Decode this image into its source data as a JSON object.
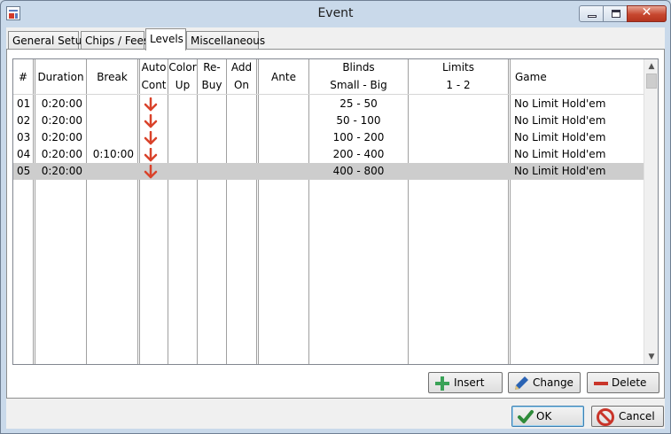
{
  "window": {
    "title": "Event"
  },
  "tabs": [
    {
      "label": "General Setup",
      "active": false
    },
    {
      "label": "Chips / Fees",
      "active": false
    },
    {
      "label": "Levels",
      "active": true
    },
    {
      "label": "Miscellaneous",
      "active": false
    }
  ],
  "columns": {
    "num": "#",
    "duration": "Duration",
    "break": "Break",
    "auto_1": "Auto",
    "auto_2": "Cont",
    "color_1": "Color",
    "color_2": "Up",
    "rebuy_1": "Re-",
    "rebuy_2": "Buy",
    "addon_1": "Add",
    "addon_2": "On",
    "ante": "Ante",
    "blinds_1": "Blinds",
    "blinds_2": "Small - Big",
    "limits_1": "Limits",
    "limits_2": "1 - 2",
    "game": "Game"
  },
  "levels": [
    {
      "num": "01",
      "duration": "0:20:00",
      "break": "",
      "blinds": "25 - 50",
      "game": "No Limit Hold'em",
      "auto_continue": true
    },
    {
      "num": "02",
      "duration": "0:20:00",
      "break": "",
      "blinds": "50 - 100",
      "game": "No Limit Hold'em",
      "auto_continue": true
    },
    {
      "num": "03",
      "duration": "0:20:00",
      "break": "",
      "blinds": "100 - 200",
      "game": "No Limit Hold'em",
      "auto_continue": true
    },
    {
      "num": "04",
      "duration": "0:20:00",
      "break": "0:10:00",
      "blinds": "200 - 400",
      "game": "No Limit Hold'em",
      "auto_continue": true
    },
    {
      "num": "05",
      "duration": "0:20:00",
      "break": "",
      "blinds": "400 - 800",
      "game": "No Limit Hold'em",
      "auto_continue": true,
      "selected": true
    }
  ],
  "buttons": {
    "insert": "Insert",
    "change": "Change",
    "delete": "Delete",
    "ok": "OK",
    "cancel": "Cancel"
  },
  "icons": {
    "arrow": "down-arrow-icon",
    "insert": "plus-icon",
    "change": "pencil-icon",
    "delete": "minus-icon",
    "ok": "checkmark-icon",
    "cancel": "cancel-icon"
  },
  "colors": {
    "arrow": "#d9422a",
    "plus": "#3aa257",
    "minus": "#c9352a",
    "pencil": "#2a63b4",
    "check": "#2e8b3a",
    "cancel": "#c9352a",
    "selected_row": "#cdcdcd"
  }
}
